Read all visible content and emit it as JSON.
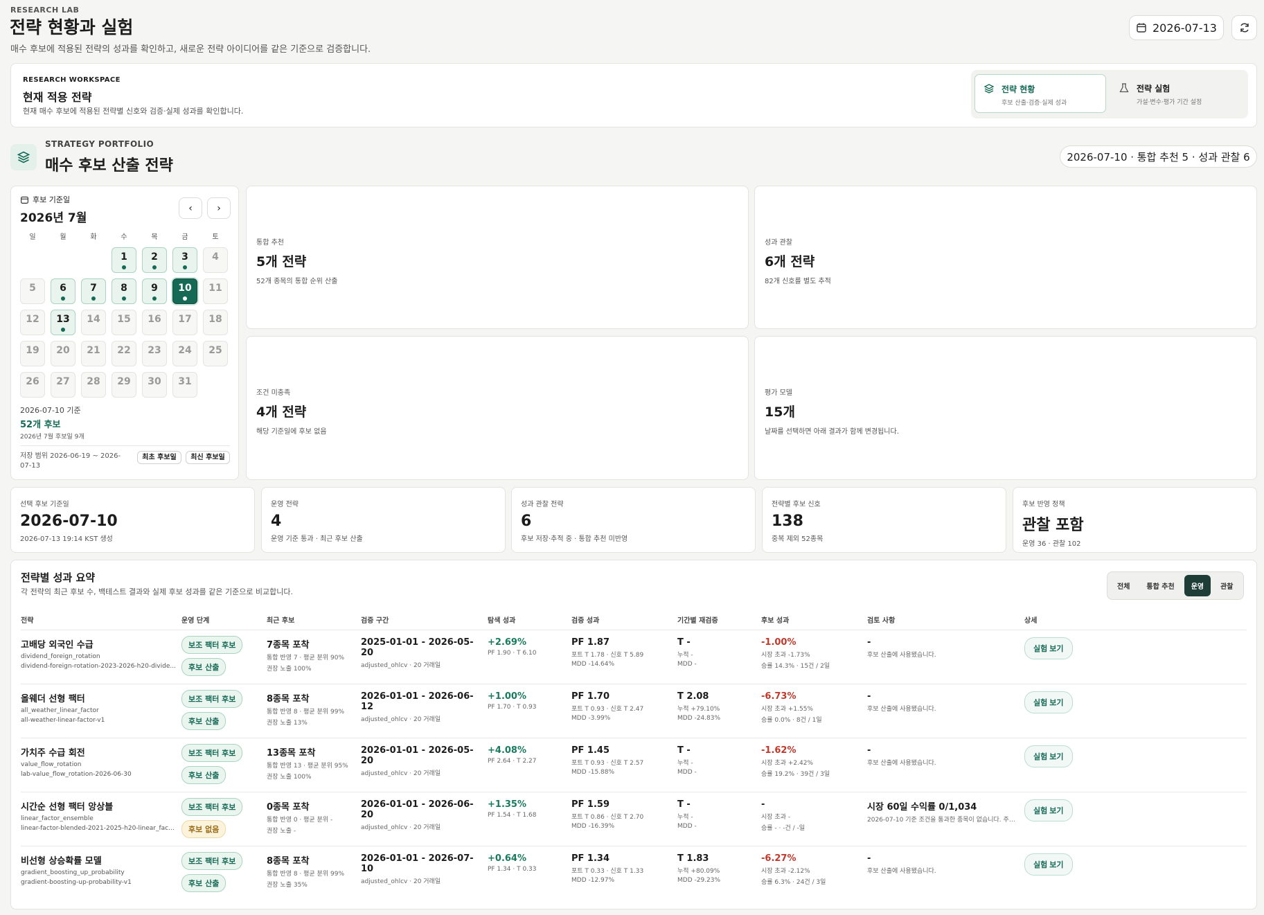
{
  "header": {
    "eyebrow": "RESEARCH LAB",
    "title": "전략 현황과 실험",
    "subtitle": "매수 후보에 적용된 전략의 성과를 확인하고, 새로운 전략 아이디어를 같은 기준으로 검증합니다.",
    "date": "2026-07-13"
  },
  "workspace": {
    "eyebrow": "RESEARCH WORKSPACE",
    "title": "현재 적용 전략",
    "desc": "현재 매수 후보에 적용된 전략별 신호와 검증·실제 성과를 확인합니다.",
    "tabs": [
      {
        "label": "전략 현황",
        "desc": "후보 산출·검증·실제 성과"
      },
      {
        "label": "전략 실험",
        "desc": "가설·변수·평가 기간 설정"
      }
    ]
  },
  "portfolio": {
    "eyebrow": "STRATEGY PORTFOLIO",
    "title": "매수 후보 산출 전략",
    "summary": "2026-07-10 · 통합 추천 5 · 성과 관찰 6"
  },
  "calendar": {
    "label": "후보 기준일",
    "month": "2026년 7월",
    "dow": [
      "일",
      "월",
      "화",
      "수",
      "목",
      "금",
      "토"
    ],
    "weeks": [
      [
        "",
        "",
        "",
        "1",
        "2",
        "3",
        "4"
      ],
      [
        "5",
        "6",
        "7",
        "8",
        "9",
        "10",
        "11"
      ],
      [
        "12",
        "13",
        "14",
        "15",
        "16",
        "17",
        "18"
      ],
      [
        "19",
        "20",
        "21",
        "22",
        "23",
        "24",
        "25"
      ],
      [
        "26",
        "27",
        "28",
        "29",
        "30",
        "31",
        ""
      ]
    ],
    "candidate_days": [
      "1",
      "2",
      "3",
      "6",
      "7",
      "8",
      "9",
      "10",
      "13"
    ],
    "selected_day": "10",
    "basis": "2026-07-10 기준",
    "count": "52개 후보",
    "month_count": "2026년 7월 후보일 9개",
    "range": "저장 범위 2026-06-19 ~ 2026-07-13",
    "first_btn": "최초 후보일",
    "latest_btn": "최신 후보일"
  },
  "summary_cards": [
    {
      "label": "통합 추천",
      "value": "5개 전략",
      "desc": "52개 종목의 통합 순위 산출"
    },
    {
      "label": "성과 관찰",
      "value": "6개 전략",
      "desc": "82개 신호를 별도 추적"
    },
    {
      "label": "조건 미충족",
      "value": "4개 전략",
      "desc": "해당 기준일에 후보 없음"
    },
    {
      "label": "평가 모델",
      "value": "15개",
      "desc": "날짜를 선택하면 아래 결과가 함께 변경됩니다."
    }
  ],
  "kpis": [
    {
      "label": "선택 후보 기준일",
      "value": "2026-07-10",
      "desc": "2026-07-13 19:14 KST 생성"
    },
    {
      "label": "운영 전략",
      "value": "4",
      "desc": "운영 기준 통과 · 최근 후보 산출"
    },
    {
      "label": "성과 관찰 전략",
      "value": "6",
      "desc": "후보 저장·추적 중 · 통합 추천 미반영"
    },
    {
      "label": "전략별 후보 신호",
      "value": "138",
      "desc": "중복 제외 52종목"
    },
    {
      "label": "후보 반영 정책",
      "value": "관찰 포함",
      "desc": "운영 36 · 관찰 102"
    }
  ],
  "perf": {
    "title": "전략별 성과 요약",
    "desc": "각 전략의 최근 후보 수, 백테스트 결과와 실제 후보 성과를 같은 기준으로 비교합니다.",
    "filters": [
      "전체",
      "통합 추천",
      "운영",
      "관찰"
    ],
    "active_filter": "운영",
    "columns": [
      "전략",
      "운영 단계",
      "최근 후보",
      "검증 구간",
      "탐색 성과",
      "검증 성과",
      "기간별 재검증",
      "후보 성과",
      "검토 사항",
      "상세"
    ],
    "rows": [
      {
        "name": "고배당 외국인 수급",
        "id": "dividend_foreign_rotation",
        "run": "dividend-foreign-rotation-2023-2026-h20-divide...",
        "badges": [
          "보조 팩터 후보",
          "후보 산출"
        ],
        "cand": "7종목 포착",
        "cand1": "통합 반영 7 · 평균 분위 90%",
        "cand2": "권장 노출 100%",
        "period": "2025-01-01 - 2026-05-20",
        "period_sub": "adjusted_ohlcv · 20 거래일",
        "explore": "+2.69%",
        "explore_sub": "PF 1.90 · T 6.10",
        "valid": "PF 1.87",
        "valid1": "포트 T 1.78 · 신호 T 5.89",
        "valid2": "MDD -14.64%",
        "re": "T -",
        "re1": "누적 -",
        "re2": "MDD -",
        "perf": "-1.00%",
        "perf1": "시장 초과 -1.73%",
        "perf2": "승률 14.3% · 15건 / 2일",
        "review": "-",
        "review_sub": "후보 산출에 사용됐습니다.",
        "btn": "실험 보기"
      },
      {
        "name": "올웨더 선형 팩터",
        "id": "all_weather_linear_factor",
        "run": "all-weather-linear-factor-v1",
        "badges": [
          "보조 팩터 후보",
          "후보 산출"
        ],
        "cand": "8종목 포착",
        "cand1": "통합 반영 8 · 평균 분위 99%",
        "cand2": "권장 노출 13%",
        "period": "2026-01-01 - 2026-06-12",
        "period_sub": "adjusted_ohlcv · 20 거래일",
        "explore": "+1.00%",
        "explore_sub": "PF 1.70 · T 0.93",
        "valid": "PF 1.70",
        "valid1": "포트 T 0.93 · 신호 T 2.47",
        "valid2": "MDD -3.99%",
        "re": "T 2.08",
        "re1": "누적 +79.10%",
        "re2": "MDD -24.83%",
        "perf": "-6.73%",
        "perf1": "시장 초과 +1.55%",
        "perf2": "승률 0.0% · 8건 / 1일",
        "review": "-",
        "review_sub": "후보 산출에 사용됐습니다.",
        "btn": "실험 보기"
      },
      {
        "name": "가치주 수급 회전",
        "id": "value_flow_rotation",
        "run": "lab-value_flow_rotation-2026-06-30",
        "badges": [
          "보조 팩터 후보",
          "후보 산출"
        ],
        "cand": "13종목 포착",
        "cand1": "통합 반영 13 · 평균 분위 95%",
        "cand2": "권장 노출 100%",
        "period": "2026-01-01 - 2026-05-20",
        "period_sub": "adjusted_ohlcv · 20 거래일",
        "explore": "+4.08%",
        "explore_sub": "PF 2.64 · T 2.27",
        "valid": "PF 1.45",
        "valid1": "포트 T 0.93 · 신호 T 2.57",
        "valid2": "MDD -15.88%",
        "re": "T -",
        "re1": "누적 -",
        "re2": "MDD -",
        "perf": "-1.62%",
        "perf1": "시장 초과 +2.42%",
        "perf2": "승률 19.2% · 39건 / 3일",
        "review": "-",
        "review_sub": "후보 산출에 사용됐습니다.",
        "btn": "실험 보기"
      },
      {
        "name": "시간순 선형 팩터 앙상블",
        "id": "linear_factor_ensemble",
        "run": "linear-factor-blended-2021-2025-h20-linear_fact...",
        "badges": [
          "보조 팩터 후보",
          "후보 없음"
        ],
        "cand": "0종목 포착",
        "cand1": "통합 반영 0 · 평균 분위 -",
        "cand2": "권장 노출 -",
        "period": "2026-01-01 - 2026-06-20",
        "period_sub": "adjusted_ohlcv · 20 거래일",
        "explore": "+1.35%",
        "explore_sub": "PF 1.54 · T 1.68",
        "valid": "PF 1.59",
        "valid1": "포트 T 0.86 · 신호 T 2.70",
        "valid2": "MDD -16.39%",
        "re": "T -",
        "re1": "누적 -",
        "re2": "MDD -",
        "perf": "-",
        "perf1": "시장 초과 -",
        "perf2": "승률 - · -건 / -일",
        "review": "시장 60일 수익률 0/1,034",
        "review_sub": "2026-07-10 기준 조건을 통과한 종목이 없습니다. 주요 병...",
        "btn": "실험 보기"
      },
      {
        "name": "비선형 상승확률 모델",
        "id": "gradient_boosting_up_probability",
        "run": "gradient-boosting-up-probability-v1",
        "badges": [
          "보조 팩터 후보",
          "후보 산출"
        ],
        "cand": "8종목 포착",
        "cand1": "통합 반영 8 · 평균 분위 99%",
        "cand2": "권장 노출 35%",
        "period": "2026-01-01 - 2026-07-10",
        "period_sub": "adjusted_ohlcv · 20 거래일",
        "explore": "+0.64%",
        "explore_sub": "PF 1.34 · T 0.33",
        "valid": "PF 1.34",
        "valid1": "포트 T 0.33 · 신호 T 1.33",
        "valid2": "MDD -12.97%",
        "re": "T 1.83",
        "re1": "누적 +80.09%",
        "re2": "MDD -29.23%",
        "perf": "-6.27%",
        "perf1": "시장 초과 -2.12%",
        "perf2": "승률 6.3% · 24건 / 3일",
        "review": "-",
        "review_sub": "후보 산출에 사용됐습니다.",
        "btn": "실험 보기"
      }
    ]
  },
  "colors": {
    "accent": "#166a55",
    "negative": "#c0392b",
    "background": "#f5f5f4"
  }
}
